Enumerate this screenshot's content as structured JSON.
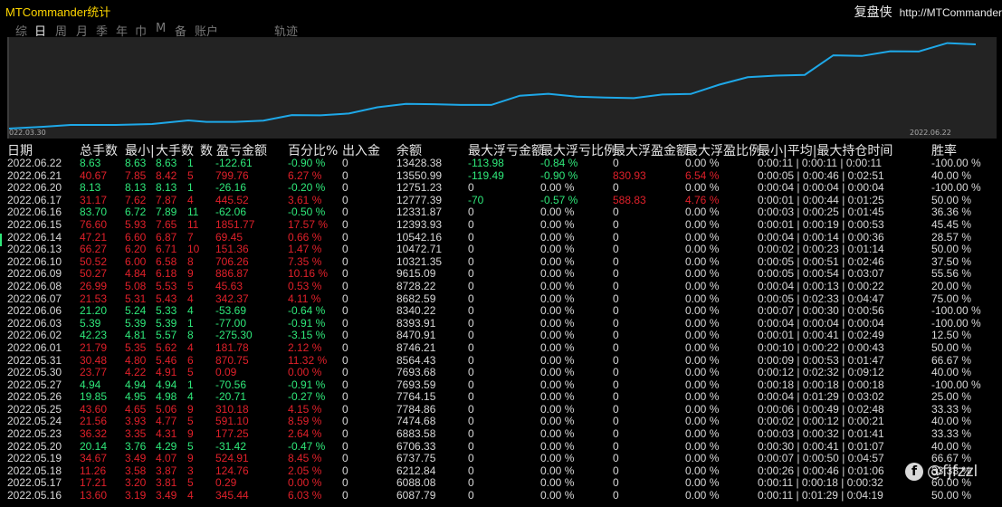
{
  "app": {
    "title": "MTCommander统计",
    "right_title": "复盘侠",
    "right_url": "http://MTCommander"
  },
  "tabs": [
    "综",
    "日",
    "周",
    "月",
    "季",
    "年",
    "巾",
    "M",
    "备",
    "账户",
    "轨迹"
  ],
  "active_tab": 1,
  "chart": {
    "start_date": "022.03.30",
    "end_date": "2022.06.22",
    "line_color": "#1ea8e8",
    "fill_color": "#232323"
  },
  "headers": [
    "日期",
    "总手数",
    "最小|",
    "大手数",
    "数",
    "盈亏金额",
    "百分比%",
    "出入金",
    "余额",
    "最大浮亏金额",
    "最大浮亏比例",
    "最大浮盈金额",
    "最大浮盈比例",
    "最小|平均|最大持仓时间",
    "胜率"
  ],
  "rows": [
    {
      "date": "2022.06.22",
      "total": "8.63",
      "min": "8.63",
      "max": "8.63",
      "n": "1",
      "pl": "-122.61",
      "pct": "-0.90 %",
      "io": "0",
      "bal": "13428.38",
      "ml": "-113.98",
      "mlp": "-0.84 %",
      "mp": "0",
      "mpp": "0.00 %",
      "t": "0:00:11 | 0:00:11 | 0:00:11",
      "win": "-100.00 %",
      "c": "pos",
      "mlc": "pos",
      "mpc": "neu"
    },
    {
      "date": "2022.06.21",
      "total": "40.67",
      "min": "7.85",
      "max": "8.42",
      "n": "5",
      "pl": "799.76",
      "pct": "6.27 %",
      "io": "0",
      "bal": "13550.99",
      "ml": "-119.49",
      "mlp": "-0.90 %",
      "mp": "830.93",
      "mpp": "6.54 %",
      "t": "0:00:05 | 0:00:46 | 0:02:51",
      "win": "40.00 %",
      "c": "neg",
      "mlc": "pos",
      "mpc": "neg"
    },
    {
      "date": "2022.06.20",
      "total": "8.13",
      "min": "8.13",
      "max": "8.13",
      "n": "1",
      "pl": "-26.16",
      "pct": "-0.20 %",
      "io": "0",
      "bal": "12751.23",
      "ml": "0",
      "mlp": "0.00 %",
      "mp": "0",
      "mpp": "0.00 %",
      "t": "0:00:04 | 0:00:04 | 0:00:04",
      "win": "-100.00 %",
      "c": "pos",
      "mlc": "neu",
      "mpc": "neu"
    },
    {
      "date": "2022.06.17",
      "total": "31.17",
      "min": "7.62",
      "max": "7.87",
      "n": "4",
      "pl": "445.52",
      "pct": "3.61 %",
      "io": "0",
      "bal": "12777.39",
      "ml": "-70",
      "mlp": "-0.57 %",
      "mp": "588.83",
      "mpp": "4.76 %",
      "t": "0:00:01 | 0:00:44 | 0:01:25",
      "win": "50.00 %",
      "c": "neg",
      "mlc": "pos",
      "mpc": "neg"
    },
    {
      "date": "2022.06.16",
      "total": "83.70",
      "min": "6.72",
      "max": "7.89",
      "n": "11",
      "pl": "-62.06",
      "pct": "-0.50 %",
      "io": "0",
      "bal": "12331.87",
      "ml": "0",
      "mlp": "0.00 %",
      "mp": "0",
      "mpp": "0.00 %",
      "t": "0:00:03 | 0:00:25 | 0:01:45",
      "win": "36.36 %",
      "c": "pos",
      "mlc": "neu",
      "mpc": "neu"
    },
    {
      "date": "2022.06.15",
      "total": "76.60",
      "min": "5.93",
      "max": "7.65",
      "n": "11",
      "pl": "1851.77",
      "pct": "17.57 %",
      "io": "0",
      "bal": "12393.93",
      "ml": "0",
      "mlp": "0.00 %",
      "mp": "0",
      "mpp": "0.00 %",
      "t": "0:00:01 | 0:00:19 | 0:00:53",
      "win": "45.45 %",
      "c": "neg",
      "mlc": "neu",
      "mpc": "neu"
    },
    {
      "date": "2022.06.14",
      "total": "47.21",
      "min": "6.60",
      "max": "6.87",
      "n": "7",
      "pl": "69.45",
      "pct": "0.66 %",
      "io": "0",
      "bal": "10542.16",
      "ml": "0",
      "mlp": "0.00 %",
      "mp": "0",
      "mpp": "0.00 %",
      "t": "0:00:04 | 0:00:14 | 0:00:36",
      "win": "28.57 %",
      "c": "neg",
      "mlc": "neu",
      "mpc": "neu"
    },
    {
      "date": "2022.06.13",
      "total": "66.27",
      "min": "6.20",
      "max": "6.71",
      "n": "10",
      "pl": "151.36",
      "pct": "1.47 %",
      "io": "0",
      "bal": "10472.71",
      "ml": "0",
      "mlp": "0.00 %",
      "mp": "0",
      "mpp": "0.00 %",
      "t": "0:00:02 | 0:00:23 | 0:01:14",
      "win": "50.00 %",
      "c": "neg",
      "mlc": "neu",
      "mpc": "neu"
    },
    {
      "date": "2022.06.10",
      "total": "50.52",
      "min": "6.00",
      "max": "6.58",
      "n": "8",
      "pl": "706.26",
      "pct": "7.35 %",
      "io": "0",
      "bal": "10321.35",
      "ml": "0",
      "mlp": "0.00 %",
      "mp": "0",
      "mpp": "0.00 %",
      "t": "0:00:05 | 0:00:51 | 0:02:46",
      "win": "37.50 %",
      "c": "neg",
      "mlc": "neu",
      "mpc": "neu"
    },
    {
      "date": "2022.06.09",
      "total": "50.27",
      "min": "4.84",
      "max": "6.18",
      "n": "9",
      "pl": "886.87",
      "pct": "10.16 %",
      "io": "0",
      "bal": "9615.09",
      "ml": "0",
      "mlp": "0.00 %",
      "mp": "0",
      "mpp": "0.00 %",
      "t": "0:00:05 | 0:00:54 | 0:03:07",
      "win": "55.56 %",
      "c": "neg",
      "mlc": "neu",
      "mpc": "neu"
    },
    {
      "date": "2022.06.08",
      "total": "26.99",
      "min": "5.08",
      "max": "5.53",
      "n": "5",
      "pl": "45.63",
      "pct": "0.53 %",
      "io": "0",
      "bal": "8728.22",
      "ml": "0",
      "mlp": "0.00 %",
      "mp": "0",
      "mpp": "0.00 %",
      "t": "0:00:04 | 0:00:13 | 0:00:22",
      "win": "20.00 %",
      "c": "neg",
      "mlc": "neu",
      "mpc": "neu"
    },
    {
      "date": "2022.06.07",
      "total": "21.53",
      "min": "5.31",
      "max": "5.43",
      "n": "4",
      "pl": "342.37",
      "pct": "4.11 %",
      "io": "0",
      "bal": "8682.59",
      "ml": "0",
      "mlp": "0.00 %",
      "mp": "0",
      "mpp": "0.00 %",
      "t": "0:00:05 | 0:02:33 | 0:04:47",
      "win": "75.00 %",
      "c": "neg",
      "mlc": "neu",
      "mpc": "neu"
    },
    {
      "date": "2022.06.06",
      "total": "21.20",
      "min": "5.24",
      "max": "5.33",
      "n": "4",
      "pl": "-53.69",
      "pct": "-0.64 %",
      "io": "0",
      "bal": "8340.22",
      "ml": "0",
      "mlp": "0.00 %",
      "mp": "0",
      "mpp": "0.00 %",
      "t": "0:00:07 | 0:00:30 | 0:00:56",
      "win": "-100.00 %",
      "c": "pos",
      "mlc": "neu",
      "mpc": "neu"
    },
    {
      "date": "2022.06.03",
      "total": "5.39",
      "min": "5.39",
      "max": "5.39",
      "n": "1",
      "pl": "-77.00",
      "pct": "-0.91 %",
      "io": "0",
      "bal": "8393.91",
      "ml": "0",
      "mlp": "0.00 %",
      "mp": "0",
      "mpp": "0.00 %",
      "t": "0:00:04 | 0:00:04 | 0:00:04",
      "win": "-100.00 %",
      "c": "pos",
      "mlc": "neu",
      "mpc": "neu"
    },
    {
      "date": "2022.06.02",
      "total": "42.23",
      "min": "4.81",
      "max": "5.57",
      "n": "8",
      "pl": "-275.30",
      "pct": "-3.15 %",
      "io": "0",
      "bal": "8470.91",
      "ml": "0",
      "mlp": "0.00 %",
      "mp": "0",
      "mpp": "0.00 %",
      "t": "0:00:01 | 0:00:41 | 0:02:49",
      "win": "12.50 %",
      "c": "pos",
      "mlc": "neu",
      "mpc": "neu"
    },
    {
      "date": "2022.06.01",
      "total": "21.79",
      "min": "5.35",
      "max": "5.62",
      "n": "4",
      "pl": "181.78",
      "pct": "2.12 %",
      "io": "0",
      "bal": "8746.21",
      "ml": "0",
      "mlp": "0.00 %",
      "mp": "0",
      "mpp": "0.00 %",
      "t": "0:00:10 | 0:00:22 | 0:00:43",
      "win": "50.00 %",
      "c": "neg",
      "mlc": "neu",
      "mpc": "neu"
    },
    {
      "date": "2022.05.31",
      "total": "30.48",
      "min": "4.80",
      "max": "5.46",
      "n": "6",
      "pl": "870.75",
      "pct": "11.32 %",
      "io": "0",
      "bal": "8564.43",
      "ml": "0",
      "mlp": "0.00 %",
      "mp": "0",
      "mpp": "0.00 %",
      "t": "0:00:09 | 0:00:53 | 0:01:47",
      "win": "66.67 %",
      "c": "neg",
      "mlc": "neu",
      "mpc": "neu"
    },
    {
      "date": "2022.05.30",
      "total": "23.77",
      "min": "4.22",
      "max": "4.91",
      "n": "5",
      "pl": "0.09",
      "pct": "0.00 %",
      "io": "0",
      "bal": "7693.68",
      "ml": "0",
      "mlp": "0.00 %",
      "mp": "0",
      "mpp": "0.00 %",
      "t": "0:00:12 | 0:02:32 | 0:09:12",
      "win": "40.00 %",
      "c": "neg",
      "mlc": "neu",
      "mpc": "neu"
    },
    {
      "date": "2022.05.27",
      "total": "4.94",
      "min": "4.94",
      "max": "4.94",
      "n": "1",
      "pl": "-70.56",
      "pct": "-0.91 %",
      "io": "0",
      "bal": "7693.59",
      "ml": "0",
      "mlp": "0.00 %",
      "mp": "0",
      "mpp": "0.00 %",
      "t": "0:00:18 | 0:00:18 | 0:00:18",
      "win": "-100.00 %",
      "c": "pos",
      "mlc": "neu",
      "mpc": "neu"
    },
    {
      "date": "2022.05.26",
      "total": "19.85",
      "min": "4.95",
      "max": "4.98",
      "n": "4",
      "pl": "-20.71",
      "pct": "-0.27 %",
      "io": "0",
      "bal": "7764.15",
      "ml": "0",
      "mlp": "0.00 %",
      "mp": "0",
      "mpp": "0.00 %",
      "t": "0:00:04 | 0:01:29 | 0:03:02",
      "win": "25.00 %",
      "c": "pos",
      "mlc": "neu",
      "mpc": "neu"
    },
    {
      "date": "2022.05.25",
      "total": "43.60",
      "min": "4.65",
      "max": "5.06",
      "n": "9",
      "pl": "310.18",
      "pct": "4.15 %",
      "io": "0",
      "bal": "7784.86",
      "ml": "0",
      "mlp": "0.00 %",
      "mp": "0",
      "mpp": "0.00 %",
      "t": "0:00:06 | 0:00:49 | 0:02:48",
      "win": "33.33 %",
      "c": "neg",
      "mlc": "neu",
      "mpc": "neu"
    },
    {
      "date": "2022.05.24",
      "total": "21.56",
      "min": "3.93",
      "max": "4.77",
      "n": "5",
      "pl": "591.10",
      "pct": "8.59 %",
      "io": "0",
      "bal": "7474.68",
      "ml": "0",
      "mlp": "0.00 %",
      "mp": "0",
      "mpp": "0.00 %",
      "t": "0:00:02 | 0:00:12 | 0:00:21",
      "win": "40.00 %",
      "c": "neg",
      "mlc": "neu",
      "mpc": "neu"
    },
    {
      "date": "2022.05.23",
      "total": "36.32",
      "min": "3.35",
      "max": "4.31",
      "n": "9",
      "pl": "177.25",
      "pct": "2.64 %",
      "io": "0",
      "bal": "6883.58",
      "ml": "0",
      "mlp": "0.00 %",
      "mp": "0",
      "mpp": "0.00 %",
      "t": "0:00:03 | 0:00:32 | 0:01:41",
      "win": "33.33 %",
      "c": "neg",
      "mlc": "neu",
      "mpc": "neu"
    },
    {
      "date": "2022.05.20",
      "total": "20.14",
      "min": "3.76",
      "max": "4.29",
      "n": "5",
      "pl": "-31.42",
      "pct": "-0.47 %",
      "io": "0",
      "bal": "6706.33",
      "ml": "0",
      "mlp": "0.00 %",
      "mp": "0",
      "mpp": "0.00 %",
      "t": "0:00:30 | 0:00:41 | 0:01:07",
      "win": "40.00 %",
      "c": "pos",
      "mlc": "neu",
      "mpc": "neu"
    },
    {
      "date": "2022.05.19",
      "total": "34.67",
      "min": "3.49",
      "max": "4.07",
      "n": "9",
      "pl": "524.91",
      "pct": "8.45 %",
      "io": "0",
      "bal": "6737.75",
      "ml": "0",
      "mlp": "0.00 %",
      "mp": "0",
      "mpp": "0.00 %",
      "t": "0:00:07 | 0:00:50 | 0:04:57",
      "win": "66.67 %",
      "c": "neg",
      "mlc": "neu",
      "mpc": "neu"
    },
    {
      "date": "2022.05.18",
      "total": "11.26",
      "min": "3.58",
      "max": "3.87",
      "n": "3",
      "pl": "124.76",
      "pct": "2.05 %",
      "io": "0",
      "bal": "6212.84",
      "ml": "0",
      "mlp": "0.00 %",
      "mp": "0",
      "mpp": "0.00 %",
      "t": "0:00:26 | 0:00:46 | 0:01:06",
      "win": "33.33 %",
      "c": "neg",
      "mlc": "neu",
      "mpc": "neu"
    },
    {
      "date": "2022.05.17",
      "total": "17.21",
      "min": "3.20",
      "max": "3.81",
      "n": "5",
      "pl": "0.29",
      "pct": "0.00 %",
      "io": "0",
      "bal": "6088.08",
      "ml": "0",
      "mlp": "0.00 %",
      "mp": "0",
      "mpp": "0.00 %",
      "t": "0:00:11 | 0:00:18 | 0:00:32",
      "win": "60.00 %",
      "c": "neg",
      "mlc": "neu",
      "mpc": "neu"
    },
    {
      "date": "2022.05.16",
      "total": "13.60",
      "min": "3.19",
      "max": "3.49",
      "n": "4",
      "pl": "345.44",
      "pct": "6.03 %",
      "io": "0",
      "bal": "6087.79",
      "ml": "0",
      "mlp": "0.00 %",
      "mp": "0",
      "mpp": "0.00 %",
      "t": "0:00:11 | 0:01:29 | 0:04:19",
      "win": "50.00 %",
      "c": "neg",
      "mlc": "neu",
      "mpc": "neu"
    }
  ],
  "watermark": {
    "icon": "facebook-icon",
    "text": "@fjfzzl"
  }
}
